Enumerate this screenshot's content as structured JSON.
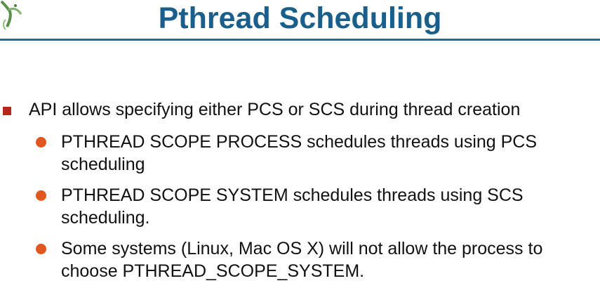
{
  "slide": {
    "title": "Pthread Scheduling",
    "bullet": "API allows specifying either PCS or SCS during thread creation",
    "sub_bullets": [
      "PTHREAD SCOPE PROCESS schedules threads using PCS scheduling",
      "PTHREAD SCOPE SYSTEM schedules threads using SCS scheduling.",
      "Some systems (Linux, Mac OS X) will not allow the process to choose PTHREAD_SCOPE_SYSTEM."
    ]
  },
  "colors": {
    "title": "#1a5f8c",
    "rule": "#1f6f9a",
    "level1_marker": "#b3271d",
    "level2_marker": "#e2571f"
  },
  "icons": {
    "logo": "dinosaur-logo-icon",
    "level1_marker": "square-bullet-icon",
    "level2_marker": "circle-bullet-icon"
  }
}
